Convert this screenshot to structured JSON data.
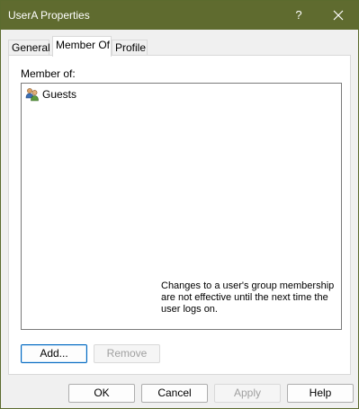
{
  "window": {
    "title": "UserA Properties",
    "help_glyph": "?",
    "titlebar_color": "#5f6b2f"
  },
  "tabs": [
    {
      "label": "General",
      "active": false
    },
    {
      "label": "Member Of",
      "active": true
    },
    {
      "label": "Profile",
      "active": false
    }
  ],
  "member_of": {
    "label": "Member of:",
    "items": [
      {
        "name": "Guests",
        "icon": "user-group-icon"
      }
    ]
  },
  "actions": {
    "add_label": "Add...",
    "remove_label": "Remove",
    "note": "Changes to a user's group membership are not effective until the next time the user logs on."
  },
  "footer": {
    "ok_label": "OK",
    "cancel_label": "Cancel",
    "apply_label": "Apply",
    "help_label": "Help"
  }
}
